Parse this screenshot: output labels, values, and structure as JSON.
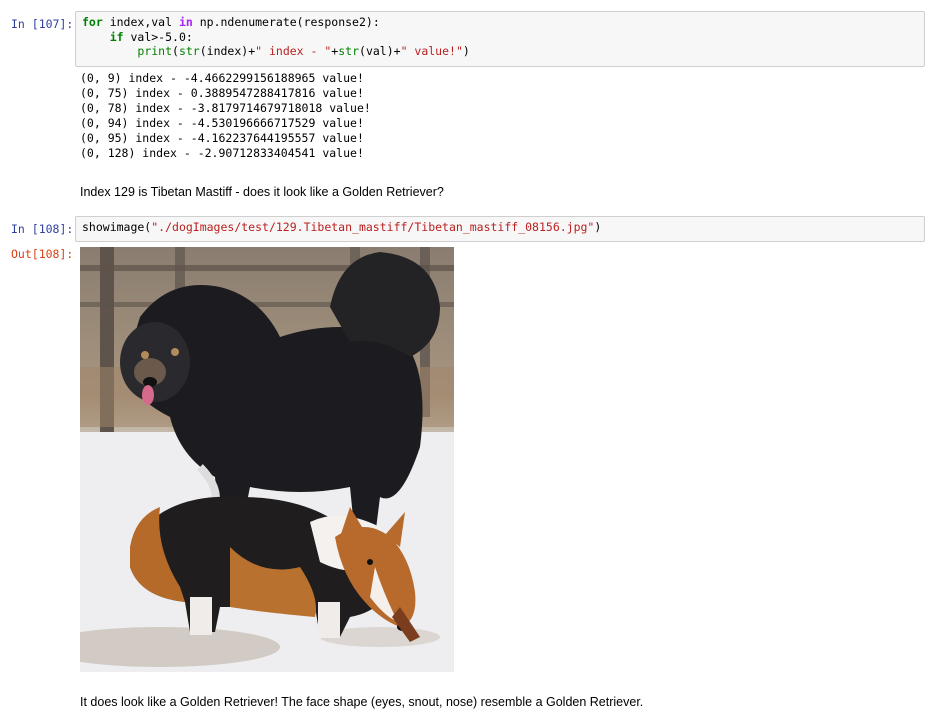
{
  "cells": {
    "c107": {
      "prompt": "In [107]:",
      "code_lines": [
        [
          {
            "t": "for",
            "c": "kw"
          },
          {
            "t": " index,val ",
            "c": ""
          },
          {
            "t": "in",
            "c": "kw2"
          },
          {
            "t": " np.ndenumerate(response2):",
            "c": ""
          }
        ],
        [
          {
            "t": "    ",
            "c": ""
          },
          {
            "t": "if",
            "c": "kw"
          },
          {
            "t": " val>-5.0:",
            "c": ""
          }
        ],
        [
          {
            "t": "        ",
            "c": ""
          },
          {
            "t": "print",
            "c": "bi"
          },
          {
            "t": "(",
            "c": ""
          },
          {
            "t": "str",
            "c": "bi"
          },
          {
            "t": "(index)+",
            "c": ""
          },
          {
            "t": "\" index - \"",
            "c": "str"
          },
          {
            "t": "+",
            "c": ""
          },
          {
            "t": "str",
            "c": "bi"
          },
          {
            "t": "(val)+",
            "c": ""
          },
          {
            "t": "\" value!\"",
            "c": "str"
          },
          {
            "t": ")",
            "c": ""
          }
        ]
      ],
      "output_lines": [
        "(0, 9) index - -4.4662299156188965 value!",
        "(0, 75) index - 0.3889547288417816 value!",
        "(0, 78) index - -3.8179714679718018 value!",
        "(0, 94) index - -4.530196666717529 value!",
        "(0, 95) index - -4.162237644195557 value!",
        "(0, 128) index - -2.90712833404541 value!"
      ]
    },
    "md1": {
      "text": "Index 129 is Tibetan Mastiff - does it look like a Golden Retriever?"
    },
    "c108": {
      "prompt": "In [108]:",
      "code_lines": [
        [
          {
            "t": "showimage(",
            "c": ""
          },
          {
            "t": "\"./dogImages/test/129.Tibetan_mastiff/Tibetan_mastiff_08156.jpg\"",
            "c": "str"
          },
          {
            "t": ")",
            "c": ""
          }
        ]
      ],
      "out_prompt": "Out[108]:"
    },
    "md2": {
      "text": "It does look like a Golden Retriever! The face shape (eyes, snout, nose) resemble a Golden Retriever."
    }
  }
}
